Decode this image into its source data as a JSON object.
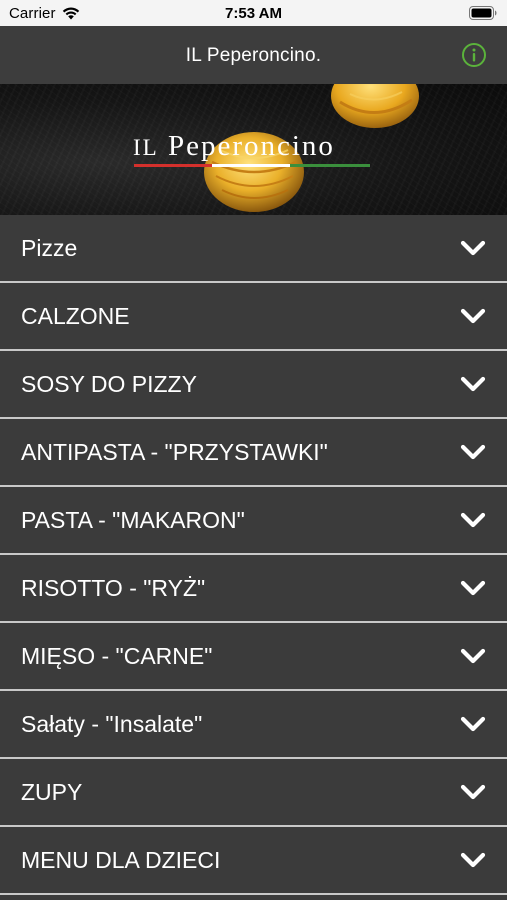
{
  "status_bar": {
    "carrier": "Carrier",
    "time": "7:53 AM",
    "icons": [
      "wifi-icon",
      "battery-icon"
    ]
  },
  "nav_bar": {
    "title": "IL Peperoncino.",
    "info_icon": "info-icon",
    "info_color": "#5bb33b"
  },
  "banner": {
    "logo_text_il": "IL",
    "logo_text_main": "Peperoncino",
    "flag_colors": [
      "#d4302c",
      "#ffffff",
      "#3a8f3c"
    ]
  },
  "menu": {
    "items": [
      {
        "label": "Pizze"
      },
      {
        "label": "CALZONE"
      },
      {
        "label": "SOSY DO PIZZY"
      },
      {
        "label": "ANTIPASTA - \"PRZYSTAWKI\""
      },
      {
        "label": "PASTA - \"MAKARON\""
      },
      {
        "label": "RISOTTO - \"RYŻ\""
      },
      {
        "label": "MIĘSO - \"CARNE\""
      },
      {
        "label": "Sałaty - \"Insalate\""
      },
      {
        "label": "ZUPY"
      },
      {
        "label": "MENU DLA DZIECI"
      }
    ],
    "expand_icon": "chevron-down-icon"
  }
}
